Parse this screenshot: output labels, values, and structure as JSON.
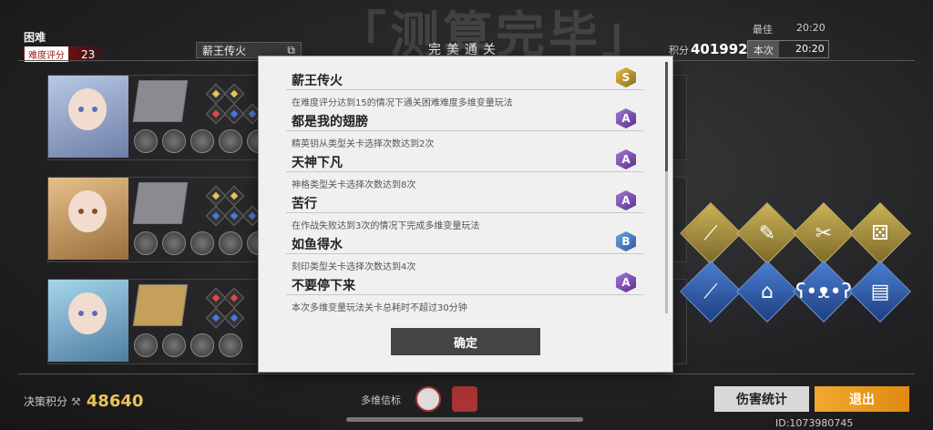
{
  "header": {
    "big_title": "「测算完毕」",
    "difficulty": "困难",
    "difficulty_score_label": "难度评分",
    "difficulty_score": "23",
    "stage_name": "薪王传火",
    "banner": "完美通关",
    "best_label": "最佳",
    "best_time": "20:20",
    "score_label": "积分",
    "score": "401992",
    "current_label": "本次",
    "current_time": "20:20"
  },
  "modal": {
    "achievements": [
      {
        "name": "薪王传火",
        "desc": "在难度评分达到15的情况下通关困难难度多维变量玩法",
        "rank": "S"
      },
      {
        "name": "都是我的翅膀",
        "desc": "精英钥从类型关卡选择次数达到2次",
        "rank": "A"
      },
      {
        "name": "天神下凡",
        "desc": "神格类型关卡选择次数达到8次",
        "rank": "A"
      },
      {
        "name": "苦行",
        "desc": "在作战失败达到3次的情况下完成多维变量玩法",
        "rank": "A"
      },
      {
        "name": "如鱼得水",
        "desc": "刻印类型关卡选择次数达到4次",
        "rank": "B"
      },
      {
        "name": "不要停下来",
        "desc": "本次多维变量玩法关卡总耗时不超过30分钟",
        "rank": "A"
      }
    ],
    "confirm_label": "确定"
  },
  "footer": {
    "decision_label": "决策积分",
    "decision_score": "48640",
    "beacon_label": "多维信标",
    "damage_stats_label": "伤害统计",
    "exit_label": "退出",
    "uid": "ID:1073980745"
  },
  "colors": {
    "accent_gold": "#e8c35a",
    "exit_orange": "#f0a830",
    "difficulty_red": "#8d1c1c"
  }
}
